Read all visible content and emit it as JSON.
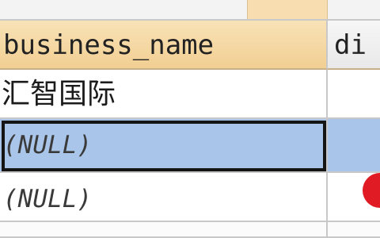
{
  "columns": [
    {
      "label": "business_name"
    },
    {
      "label": "di"
    }
  ],
  "rows": [
    {
      "business_name": "汇智国际",
      "di": ""
    },
    {
      "business_name": "(NULL)",
      "di": "",
      "selected": true
    },
    {
      "business_name": "(NULL)",
      "di": ""
    }
  ],
  "colors": {
    "header_bg": "#f2cf92",
    "selected_row_bg": "#a9c6ea",
    "gridline": "#c8c8c8",
    "marker": "#e01b24"
  }
}
